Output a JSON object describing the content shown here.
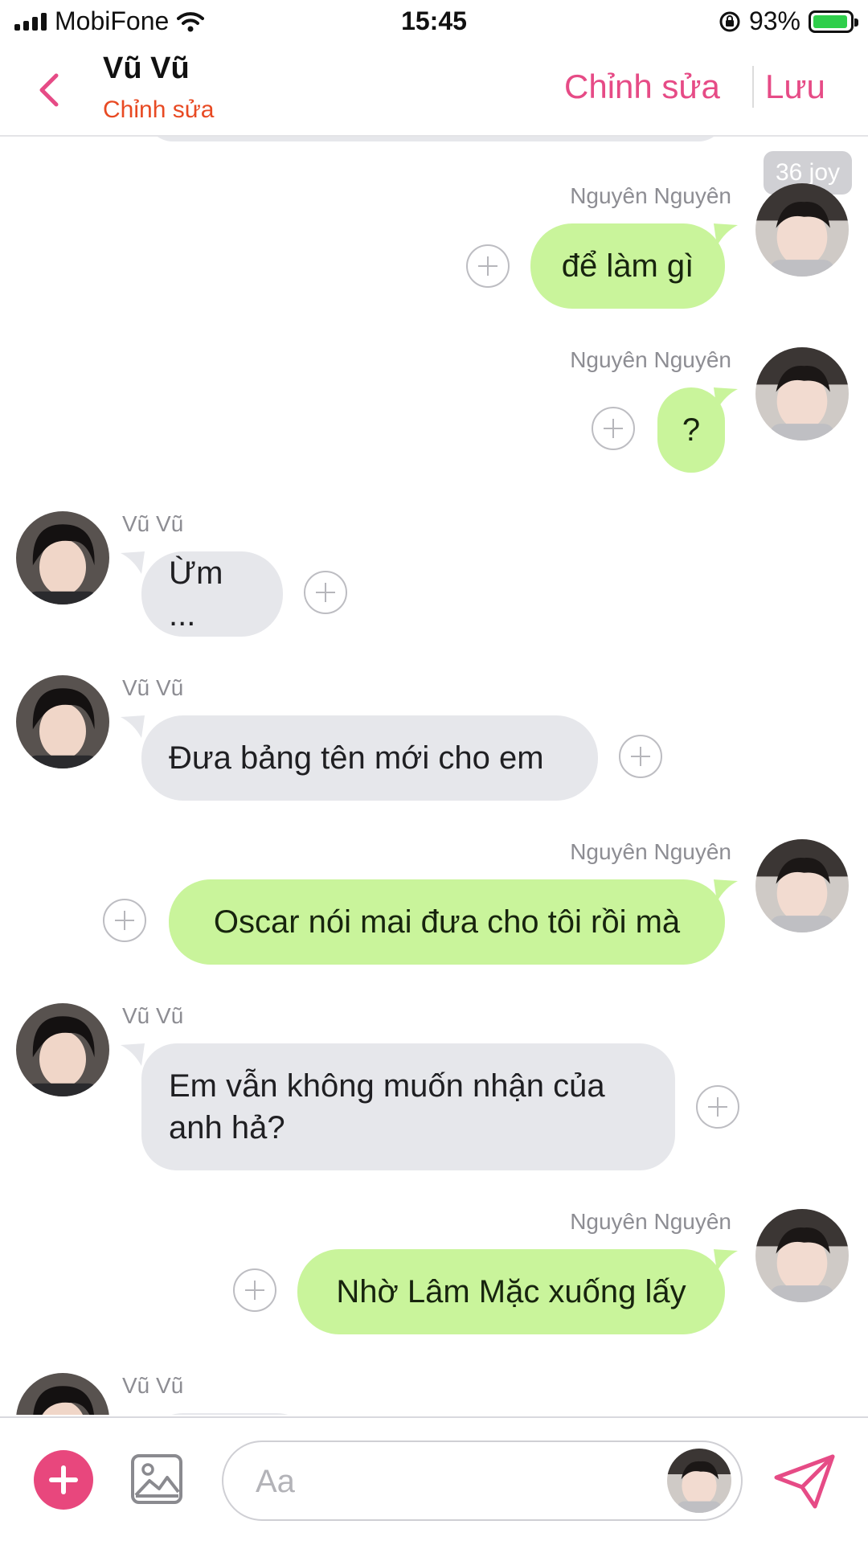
{
  "status_bar": {
    "carrier": "MobiFone",
    "time": "15:45",
    "battery": "93%"
  },
  "header": {
    "title": "Vũ Vũ",
    "subtitle": "Chỉnh sửa",
    "edit_label": "Chỉnh sửa",
    "save_label": "Lưu"
  },
  "joy_badge": "36 joy",
  "messages": [
    {
      "sender": "Nguyên Nguyên",
      "side": "right",
      "text": "để làm gì"
    },
    {
      "sender": "Nguyên Nguyên",
      "side": "right",
      "text": "?"
    },
    {
      "sender": "Vũ Vũ",
      "side": "left",
      "text": "Ừm ..."
    },
    {
      "sender": "Vũ Vũ",
      "side": "left",
      "text": "Đưa bảng tên mới cho em"
    },
    {
      "sender": "Nguyên Nguyên",
      "side": "right",
      "text": "Oscar nói mai đưa cho tôi rồi mà"
    },
    {
      "sender": "Vũ Vũ",
      "side": "left",
      "text": "Em vẫn không muốn nhận của anh hả?"
    },
    {
      "sender": "Nguyên Nguyên",
      "side": "right",
      "text": "Nhờ Lâm Mặc xuống lấy"
    },
    {
      "sender": "Vũ Vũ",
      "side": "left",
      "text": ""
    }
  ],
  "composer": {
    "placeholder": "Aa"
  },
  "icons": {
    "back": "chevron-left-icon",
    "add": "plus-icon",
    "image": "image-icon",
    "send": "send-icon",
    "react": "plus-circle-icon"
  },
  "colors": {
    "accent": "#e64b86",
    "subtitle": "#e84a23",
    "green_bubble": "#c9f49b",
    "gray_bubble": "#e6e7eb"
  }
}
